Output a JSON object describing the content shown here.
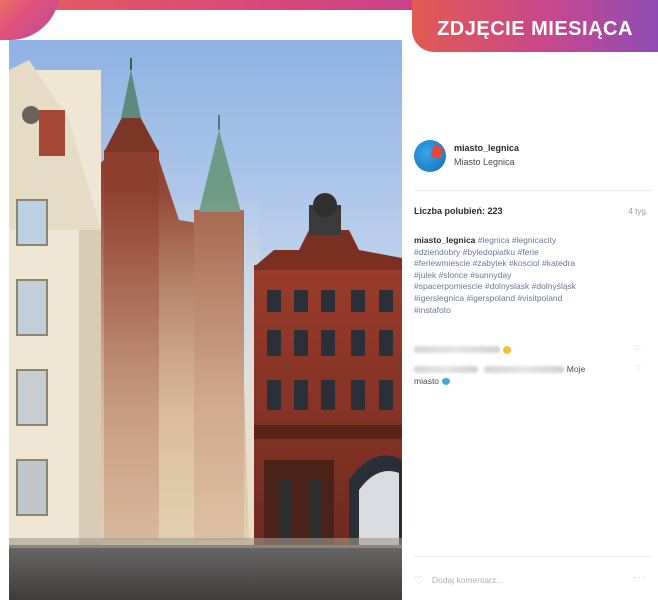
{
  "banner": {
    "title": "ZDJĘCIE MIESIĄCA"
  },
  "post": {
    "username": "miasto_legnica",
    "full_name": "Miasto Legnica",
    "likes_text": "Liczba polubień: 223",
    "age": "4 tyg.",
    "caption_user": "miasto_legnica",
    "caption_lines": [
      "#legnica #legnicacity",
      "#dziendobry #byledopiatku #ferie",
      "#feriewmiescie #zabytek #kosciol #katedra",
      "#julek #slonce #sunnyday",
      "#spacerpomiescie #dolnyslask #dolnyśląsk",
      "#igerslegnica #igerspoland #visitpoland",
      "#instafoto"
    ],
    "comment2_text_a": "Moje",
    "comment2_text_b": "miasto",
    "add_comment_placeholder": "Dodaj komentarz...",
    "more": "···"
  },
  "icons": {
    "heart": "heart-outline-icon",
    "more": "more-dots-icon"
  },
  "colors": {
    "accent_start": "#e25a52",
    "accent_end": "#8e4cb5",
    "brick": "#8a3a2a"
  }
}
